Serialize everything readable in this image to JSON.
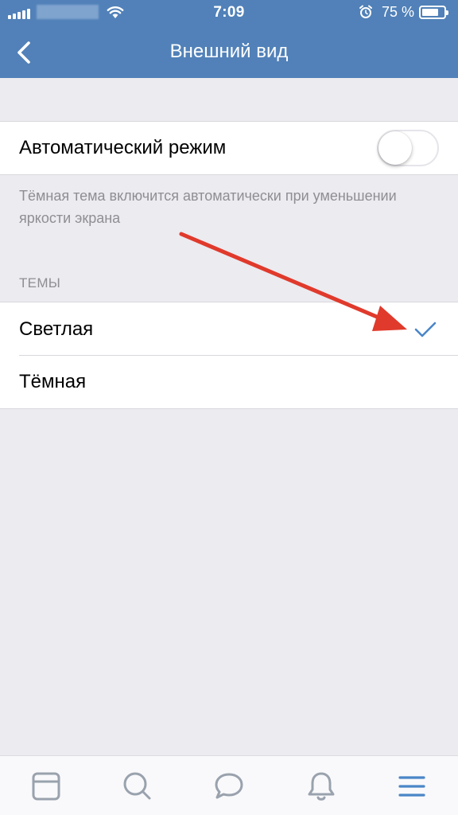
{
  "status_bar": {
    "time": "7:09",
    "battery_percent": "75 %",
    "battery_level": 0.75
  },
  "nav": {
    "title": "Внешний вид",
    "back_icon": "chevron-left-icon"
  },
  "auto_mode": {
    "label": "Автоматический режим",
    "enabled": false,
    "hint": "Тёмная тема включится автоматически при уменьшении яркости экрана"
  },
  "themes": {
    "header": "ТЕМЫ",
    "options": [
      {
        "label": "Светлая",
        "selected": true
      },
      {
        "label": "Тёмная",
        "selected": false
      }
    ]
  },
  "colors": {
    "brand": "#5181b8",
    "check": "#4a86c8",
    "annotation_arrow": "#e03a2c"
  },
  "tab_bar": {
    "items": [
      {
        "icon": "newsfeed-icon"
      },
      {
        "icon": "search-icon"
      },
      {
        "icon": "messages-icon"
      },
      {
        "icon": "notifications-bell-icon"
      },
      {
        "icon": "menu-icon",
        "active": true
      }
    ]
  }
}
